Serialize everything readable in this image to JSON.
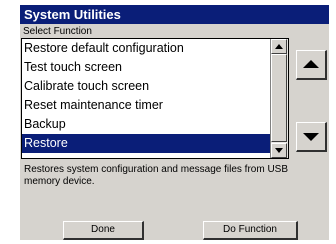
{
  "dialog": {
    "title": "System Utilities",
    "select_label": "Select Function",
    "description": "Restores system configuration and message files from USB memory device."
  },
  "functions": [
    {
      "label": "Restore default configuration",
      "selected": false
    },
    {
      "label": "Test touch screen",
      "selected": false
    },
    {
      "label": "Calibrate touch screen",
      "selected": false
    },
    {
      "label": "Reset maintenance timer",
      "selected": false
    },
    {
      "label": "Backup",
      "selected": false
    },
    {
      "label": "Restore",
      "selected": true
    }
  ],
  "buttons": {
    "done": "Done",
    "do_function": "Do Function"
  },
  "icons": {
    "scroll_up": "triangle-up-icon",
    "scroll_down": "triangle-down-icon"
  },
  "colors": {
    "title_bar": "#0a1e78",
    "selection": "#0a1e78",
    "dialog_bg": "#d6d3ce"
  }
}
